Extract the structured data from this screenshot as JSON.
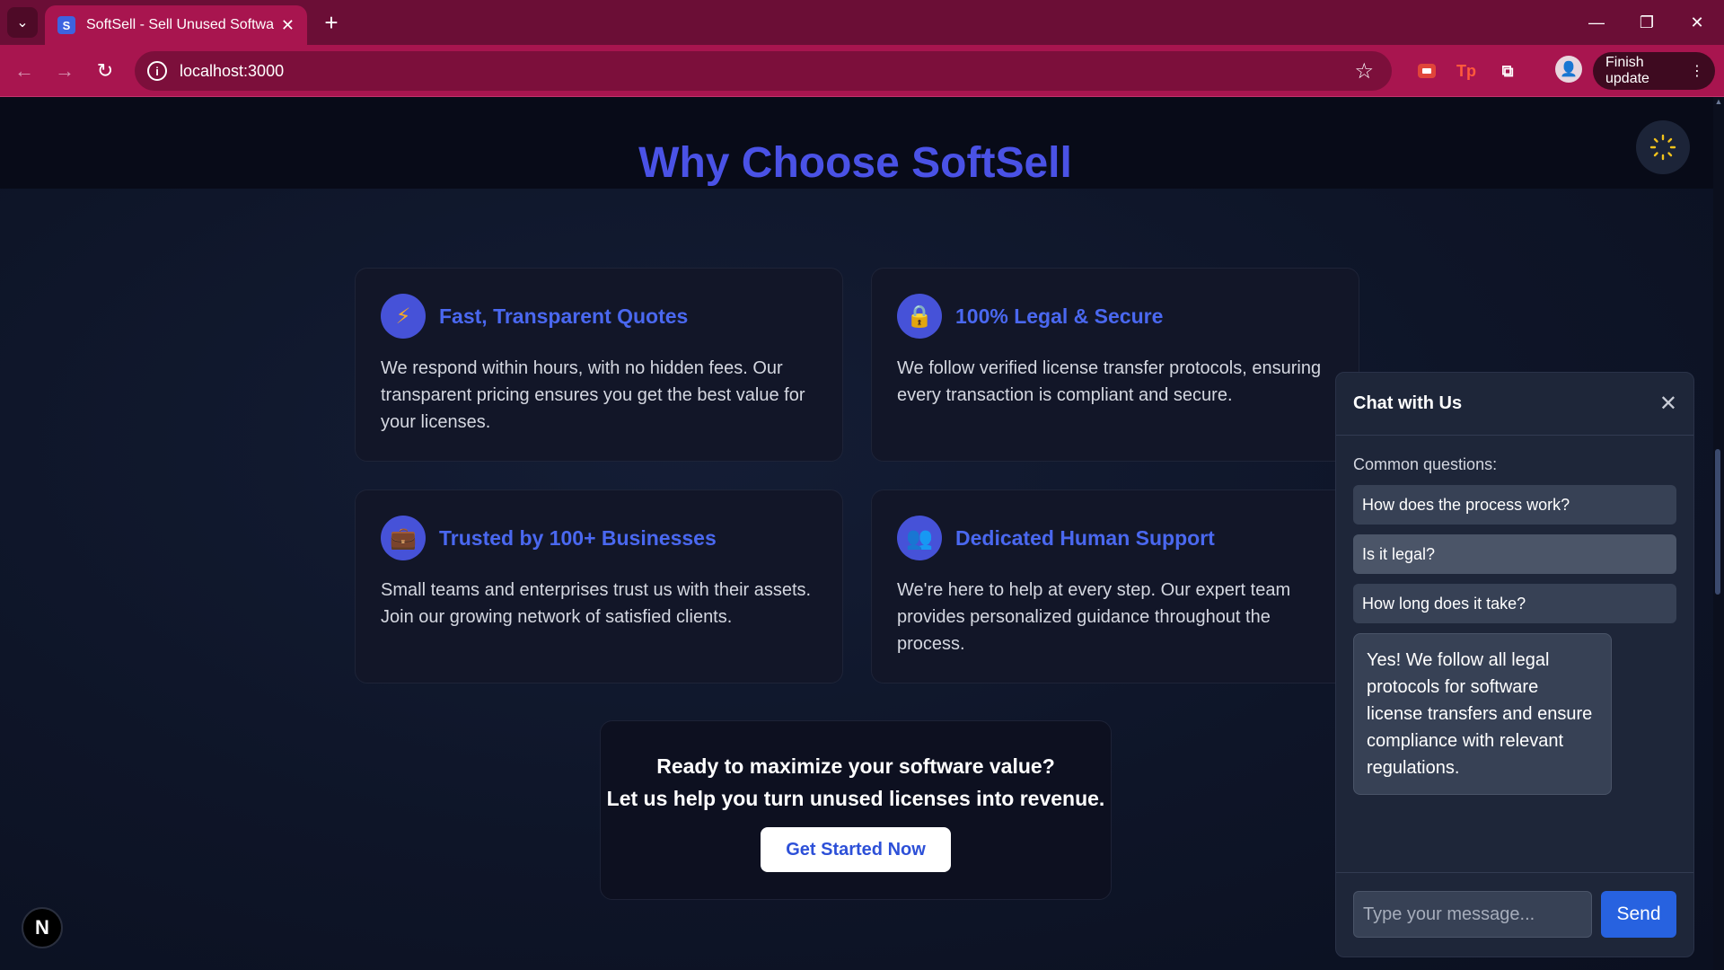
{
  "browser": {
    "tab_title": "SoftSell - Sell Unused Software",
    "favicon_letter": "S",
    "url": "localhost:3000",
    "finish_update_label": "Finish update",
    "new_tab_symbol": "+",
    "accent_color": "#a8154f"
  },
  "page": {
    "section_title": "Why Choose SoftSell",
    "title_color": "#4a52e6",
    "features": [
      {
        "icon": "lightning-icon",
        "icon_glyph": "⚡",
        "title": "Fast, Transparent Quotes",
        "text": "We respond within hours, with no hidden fees. Our transparent pricing ensures you get the best value for your licenses."
      },
      {
        "icon": "lock-icon",
        "icon_glyph": "🔒",
        "title": "100% Legal & Secure",
        "text": "We follow verified license transfer protocols, ensuring every transaction is compliant and secure."
      },
      {
        "icon": "briefcase-icon",
        "icon_glyph": "💼",
        "title": "Trusted by 100+ Businesses",
        "text": "Small teams and enterprises trust us with their assets. Join our growing network of satisfied clients."
      },
      {
        "icon": "people-icon",
        "icon_glyph": "👥",
        "title": "Dedicated Human Support",
        "text": "We're here to help at every step. Our expert team provides personalized guidance throughout the process."
      }
    ],
    "cta": {
      "line1": "Ready to maximize your software value?",
      "line2": "Let us help you turn unused licenses into revenue.",
      "button_label": "Get Started Now"
    },
    "n_badge": "N"
  },
  "chat": {
    "title": "Chat with Us",
    "common_label": "Common questions:",
    "questions": [
      {
        "label": "How does the process work?",
        "active": false
      },
      {
        "label": "Is it legal?",
        "active": true
      },
      {
        "label": "How long does it take?",
        "active": false
      }
    ],
    "answer": "Yes! We follow all legal protocols for software license transfers and ensure compliance with relevant regulations.",
    "input_placeholder": "Type your message...",
    "input_value": "",
    "send_label": "Send",
    "send_color": "#2762e0"
  }
}
